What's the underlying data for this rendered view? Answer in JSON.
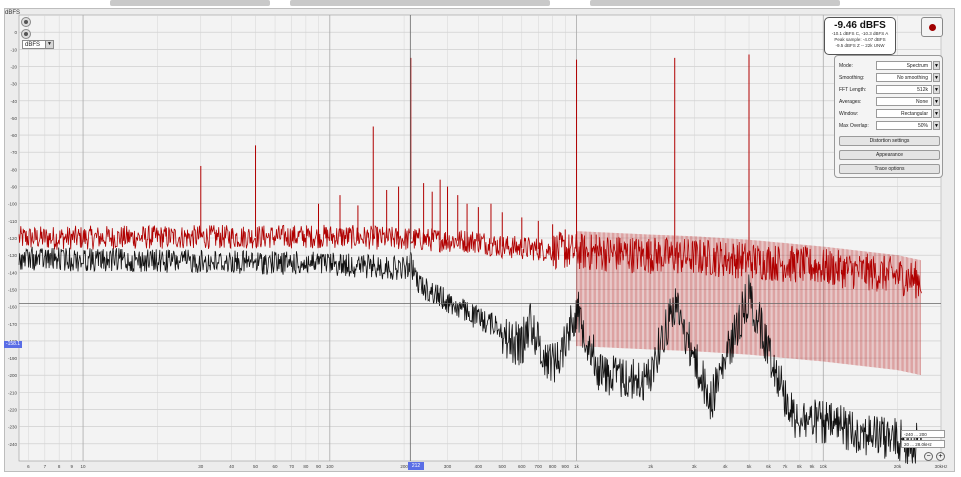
{
  "app": {
    "window_title": "Spectrum"
  },
  "axis": {
    "y_unit": "dBFS",
    "y_ticks": [
      "0",
      "-10",
      "-20",
      "-30",
      "-40",
      "-50",
      "-60",
      "-70",
      "-80",
      "-90",
      "-100",
      "-110",
      "-120",
      "-130",
      "-140",
      "-150",
      "-160",
      "-170",
      "-180",
      "-190",
      "-200",
      "-210",
      "-220",
      "-230",
      "-240"
    ],
    "x_ticks": [
      {
        "f": 6,
        "t": "6"
      },
      {
        "f": 7,
        "t": "7"
      },
      {
        "f": 8,
        "t": "8"
      },
      {
        "f": 9,
        "t": "9"
      },
      {
        "f": 10,
        "t": "10"
      },
      {
        "f": 30,
        "t": "30"
      },
      {
        "f": 40,
        "t": "40"
      },
      {
        "f": 50,
        "t": "50"
      },
      {
        "f": 60,
        "t": "60"
      },
      {
        "f": 70,
        "t": "70"
      },
      {
        "f": 80,
        "t": "80"
      },
      {
        "f": 90,
        "t": "90"
      },
      {
        "f": 100,
        "t": "100"
      },
      {
        "f": 200,
        "t": "200"
      },
      {
        "f": 300,
        "t": "300"
      },
      {
        "f": 400,
        "t": "400"
      },
      {
        "f": 500,
        "t": "500"
      },
      {
        "f": 600,
        "t": "600"
      },
      {
        "f": 700,
        "t": "700"
      },
      {
        "f": 800,
        "t": "800"
      },
      {
        "f": 900,
        "t": "900"
      },
      {
        "f": 1000,
        "t": "1k"
      },
      {
        "f": 2000,
        "t": "2k"
      },
      {
        "f": 3000,
        "t": "3k"
      },
      {
        "f": 4000,
        "t": "4k"
      },
      {
        "f": 5000,
        "t": "5k"
      },
      {
        "f": 6000,
        "t": "6k"
      },
      {
        "f": 7000,
        "t": "7k"
      },
      {
        "f": 8000,
        "t": "8k"
      },
      {
        "f": 9000,
        "t": "9k"
      },
      {
        "f": 10000,
        "t": "10k"
      },
      {
        "f": 20000,
        "t": "20k"
      },
      {
        "f": 30000,
        "t": "30kHz"
      }
    ],
    "unit_select": "dBFS"
  },
  "cursor": {
    "y_readout": "-158.1",
    "x_readout": "212"
  },
  "level_meter": {
    "main": "-9.46 dBFS",
    "line1": "-10.1 dBFS C, -10.3 dBFS A",
    "line2": "Peak sample: -4.07 dBFS",
    "line3": "-9.5 dBFS Z -- 22k UNW"
  },
  "settings": [
    {
      "label": "Mode:",
      "value": "Spectrum"
    },
    {
      "label": "Smoothing:",
      "value": "No smoothing"
    },
    {
      "label": "FFT Length:",
      "value": "512k"
    },
    {
      "label": "Averages:",
      "value": "None"
    },
    {
      "label": "Window:",
      "value": "Rectangular"
    },
    {
      "label": "Max Overlap:",
      "value": "50%"
    }
  ],
  "buttons": {
    "distortion": "Distortion settings",
    "appearance": "Appearance",
    "trace": "Trace options"
  },
  "ranges": {
    "top": "-240 ... 200",
    "bottom": "20 ... 28.0kHz"
  },
  "colors": {
    "red_trace": "#b00000",
    "black_trace": "#111111",
    "cursor_tag": "#5a6ee6",
    "plot_bg": "#ececec"
  },
  "chart_data": {
    "type": "line",
    "xscale": "log",
    "xlim": [
      5.5,
      30000
    ],
    "ylim": [
      -250,
      10
    ],
    "grid": true,
    "series": [
      {
        "color": "#b00000",
        "noise_floor": [
          [
            5.5,
            -120
          ],
          [
            100,
            -119
          ],
          [
            400,
            -122
          ],
          [
            500,
            -125
          ],
          [
            1000,
            -128
          ],
          [
            2000,
            -130
          ],
          [
            3000,
            -131
          ],
          [
            5000,
            -133
          ],
          [
            10000,
            -137
          ],
          [
            20000,
            -142
          ],
          [
            25000,
            -145
          ]
        ],
        "spikes": [
          [
            30,
            -78
          ],
          [
            50,
            -66
          ],
          [
            150,
            -55
          ],
          [
            213,
            -15
          ],
          [
            1000,
            -16
          ],
          [
            2500,
            -15
          ],
          [
            5000,
            -13
          ],
          [
            90,
            -100
          ],
          [
            110,
            -95
          ],
          [
            130,
            -101
          ],
          [
            170,
            -92
          ],
          [
            190,
            -90
          ],
          [
            240,
            -88
          ],
          [
            260,
            -93
          ],
          [
            280,
            -86
          ],
          [
            300,
            -90
          ],
          [
            330,
            -95
          ],
          [
            360,
            -100
          ],
          [
            400,
            -102
          ],
          [
            450,
            -100
          ],
          [
            500,
            -105
          ],
          [
            600,
            -108
          ],
          [
            700,
            -110
          ],
          [
            800,
            -112
          ],
          [
            900,
            -115
          ],
          [
            1200,
            -118
          ],
          [
            1500,
            -120
          ],
          [
            2000,
            -122
          ]
        ]
      },
      {
        "color": "#111111",
        "noise_floor": [
          [
            5.5,
            -125
          ],
          [
            100,
            -128
          ],
          [
            200,
            -131
          ],
          [
            212,
            -128
          ],
          [
            230,
            -140
          ],
          [
            300,
            -150
          ],
          [
            400,
            -160
          ],
          [
            500,
            -165
          ],
          [
            600,
            -170
          ],
          [
            700,
            -175
          ],
          [
            800,
            -178
          ],
          [
            1000,
            -182
          ],
          [
            1500,
            -188
          ],
          [
            2000,
            -192
          ],
          [
            3000,
            -200
          ],
          [
            5000,
            -205
          ],
          [
            10000,
            -215
          ],
          [
            20000,
            -225
          ],
          [
            25000,
            -228
          ]
        ],
        "peaks": [
          [
            213,
            -128
          ],
          [
            650,
            -155
          ],
          [
            1000,
            -148
          ],
          [
            2500,
            -145
          ],
          [
            5000,
            -140
          ]
        ]
      }
    ]
  }
}
